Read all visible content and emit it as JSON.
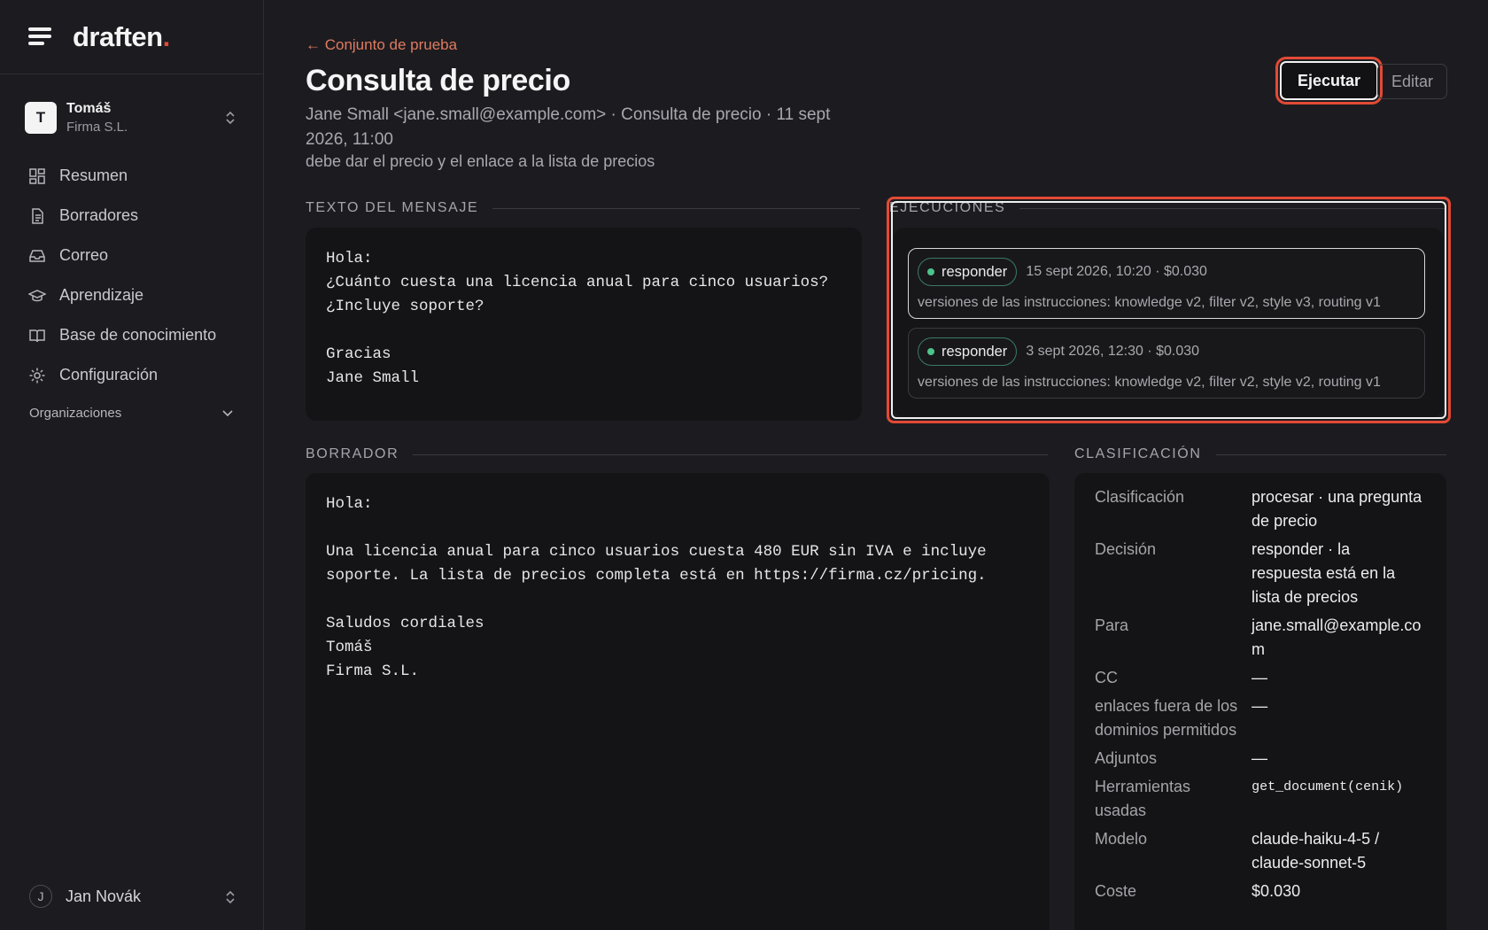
{
  "app": {
    "logo_text": "draften",
    "logo_dot": "."
  },
  "org": {
    "initial": "T",
    "name": "Tomáš",
    "subtitle": "Firma S.L."
  },
  "nav": [
    {
      "label": "Resumen",
      "icon": "dashboard-icon"
    },
    {
      "label": "Borradores",
      "icon": "document-icon"
    },
    {
      "label": "Correo",
      "icon": "inbox-icon"
    },
    {
      "label": "Aprendizaje",
      "icon": "graduation-cap-icon"
    },
    {
      "label": "Base de conocimiento",
      "icon": "book-icon"
    },
    {
      "label": "Configuración",
      "icon": "gear-icon"
    }
  ],
  "organizations_label": "Organizaciones",
  "user": {
    "initial": "J",
    "name": "Jan Novák"
  },
  "header": {
    "back_link": "← Conjunto de prueba",
    "title": "Consulta de precio",
    "meta": "Jane Small <jane.small@example.com> · Consulta de precio · 11 sept 2026, 11:00",
    "note": "debe dar el precio y el enlace a la lista de precios",
    "run_button": "Ejecutar",
    "edit_button": "Editar"
  },
  "message": {
    "label": "TEXTO DEL MENSAJE",
    "body": "Hola:\n¿Cuánto cuesta una licencia anual para cinco usuarios?\n¿Incluye soporte?\n\nGracias\nJane Small"
  },
  "runs": {
    "label": "EJECUCIONES",
    "items": [
      {
        "decision": "responder",
        "meta": "15 sept 2026, 10:20 · $0.030",
        "versions": "versiones de las instrucciones: knowledge v2, filter v2, style v3, routing v1"
      },
      {
        "decision": "responder",
        "meta": "3 sept 2026, 12:30 · $0.030",
        "versions": "versiones de las instrucciones: knowledge v2, filter v2, style v2, routing v1"
      }
    ]
  },
  "draft": {
    "label": "BORRADOR",
    "body": "Hola:\n\nUna licencia anual para cinco usuarios cuesta 480 EUR sin IVA e incluye\nsoporte. La lista de precios completa está en https://firma.cz/pricing.\n\nSaludos cordiales\nTomáš\nFirma S.L."
  },
  "classification": {
    "label": "CLASIFICACIÓN",
    "rows": [
      {
        "key": "Clasificación",
        "value": "procesar · una pregunta de precio"
      },
      {
        "key": "Decisión",
        "value": "responder · la respuesta está en la lista de precios"
      },
      {
        "key": "Para",
        "value": "jane.small@example.com"
      },
      {
        "key": "CC",
        "value": "—"
      },
      {
        "key": "enlaces fuera de los dominios permitidos",
        "value": "—"
      },
      {
        "key": "Adjuntos",
        "value": "—"
      },
      {
        "key": "Herramientas usadas",
        "value": "get_document(cenik)"
      },
      {
        "key": "Modelo",
        "value": "claude-haiku-4-5 / claude-sonnet-5"
      },
      {
        "key": "Coste",
        "value": "$0.030"
      }
    ]
  }
}
